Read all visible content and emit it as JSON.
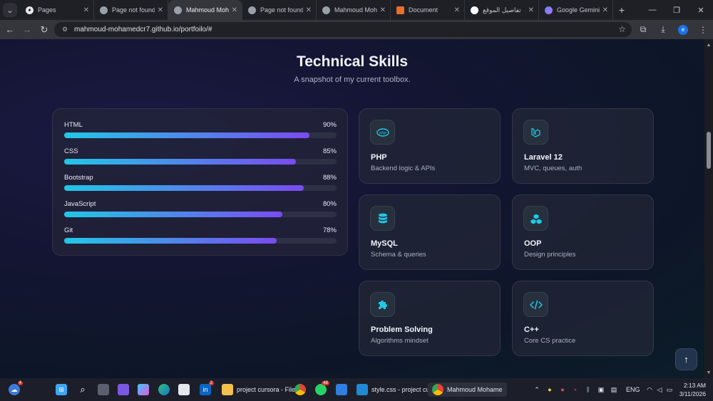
{
  "browser": {
    "tabs": [
      {
        "title": "Pages",
        "icon": "github-icon"
      },
      {
        "title": "Page not found",
        "icon": "globe-icon"
      },
      {
        "title": "Mahmoud Moha",
        "icon": "globe-icon",
        "active": true
      },
      {
        "title": "Page not found",
        "icon": "globe-icon"
      },
      {
        "title": "Mahmoud Moha",
        "icon": "globe-icon"
      },
      {
        "title": "Document",
        "icon": "document-icon"
      },
      {
        "title": "تفاصيل الموقع",
        "icon": "chatgpt-icon"
      },
      {
        "title": "Google Gemini",
        "icon": "gemini-icon"
      }
    ],
    "url": "mahmoud-mohamedcr7.github.io/portfoilo/#",
    "profile_initial": "e"
  },
  "section": {
    "title": "Technical Skills",
    "subtitle": "A snapshot of my current toolbox."
  },
  "skills": [
    {
      "name": "HTML",
      "percent_label": "90%",
      "percent": 90
    },
    {
      "name": "CSS",
      "percent_label": "85%",
      "percent": 85
    },
    {
      "name": "Bootstrap",
      "percent_label": "88%",
      "percent": 88
    },
    {
      "name": "JavaScript",
      "percent_label": "80%",
      "percent": 80
    },
    {
      "name": "Git",
      "percent_label": "78%",
      "percent": 78
    }
  ],
  "tiles": [
    {
      "title": "PHP",
      "desc": "Backend logic & APIs",
      "icon": "php-icon"
    },
    {
      "title": "Laravel 12",
      "desc": "MVC, queues, auth",
      "icon": "laravel-icon"
    },
    {
      "title": "MySQL",
      "desc": "Schema & queries",
      "icon": "database-icon"
    },
    {
      "title": "OOP",
      "desc": "Design principles",
      "icon": "cubes-icon"
    },
    {
      "title": "Problem Solving",
      "desc": "Algorithms mindset",
      "icon": "puzzle-icon"
    },
    {
      "title": "C++",
      "desc": "Core CS practice",
      "icon": "code-icon"
    }
  ],
  "taskbar": {
    "weather_badge": "4",
    "linkedin_badge": "2",
    "whatsapp_badge": "48",
    "apps": [
      {
        "label": "project cursora - File"
      },
      {
        "label": "style.css - project cu"
      },
      {
        "label": "Mahmoud Mohame"
      }
    ],
    "language": "ENG",
    "time": "2:13 AM",
    "date": "3/11/2026"
  },
  "colors": {
    "accent_start": "#22c7e6",
    "accent_end": "#7a4bf0",
    "icon_color": "#22c7e6"
  }
}
